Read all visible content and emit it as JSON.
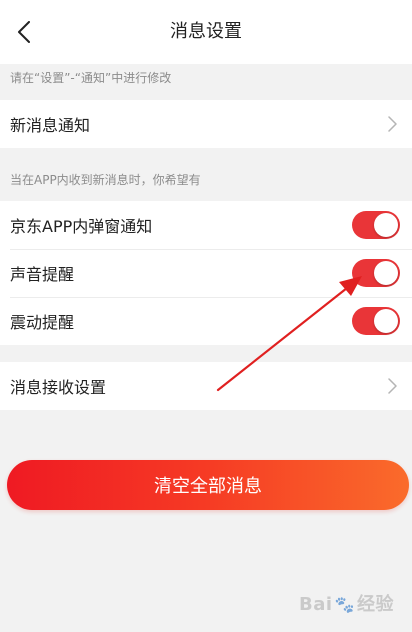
{
  "nav": {
    "title": "消息设置"
  },
  "hints": {
    "modify": "请在“设置”-“通知”中进行修改",
    "receive": "当在APP内收到新消息时，你希望有"
  },
  "section_notify": {
    "label": "新消息通知"
  },
  "section_alerts": {
    "items": [
      {
        "label": "京东APP内弹窗通知",
        "on": true
      },
      {
        "label": "声音提醒",
        "on": true
      },
      {
        "label": "震动提醒",
        "on": true
      }
    ]
  },
  "section_receive": {
    "label": "消息接收设置"
  },
  "clear_button": {
    "label": "清空全部消息"
  },
  "watermark": {
    "text_left": "Bai",
    "text_right": "经验"
  },
  "colors": {
    "accent": "#e93538",
    "annotation_arrow": "#e02020"
  },
  "icons": {
    "back": "chevron-left-icon",
    "row_chevron": "chevron-right-icon",
    "watermark_paw": "paw-icon"
  }
}
